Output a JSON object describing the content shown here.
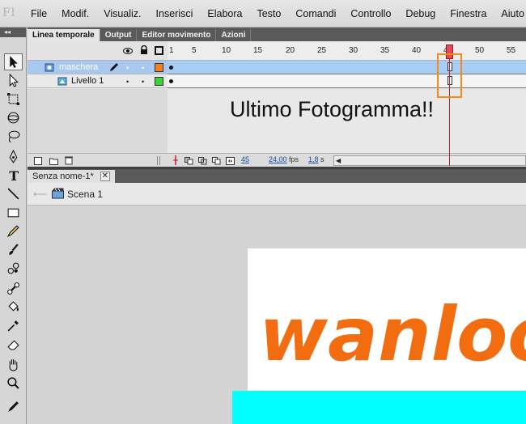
{
  "app": {
    "logo": "Fl"
  },
  "menubar": {
    "items": [
      "File",
      "Modif.",
      "Visualiz.",
      "Inserisci",
      "Elabora",
      "Testo",
      "Comandi",
      "Controllo",
      "Debug",
      "Finestra",
      "Aiuto"
    ]
  },
  "toolbar": {
    "collapse": "◂◂"
  },
  "timeline_panel": {
    "tabs": [
      {
        "label": "Linea temporale",
        "active": true
      },
      {
        "label": "Output",
        "active": false
      },
      {
        "label": "Editor movimento",
        "active": false
      },
      {
        "label": "Azioni",
        "active": false
      }
    ],
    "ruler": [
      "1",
      "5",
      "10",
      "15",
      "20",
      "25",
      "30",
      "35",
      "40",
      "45",
      "50",
      "55"
    ],
    "layers": [
      {
        "name": "maschera",
        "selected": true,
        "color": "#f08020"
      },
      {
        "name": "Livello 1",
        "selected": false,
        "color": "#3cd23c"
      }
    ],
    "annotation": "Ultimo Fotogramma!!",
    "footer": {
      "current_frame": "45",
      "fps_value": "24,00",
      "fps_label": "fps",
      "time_value": "1,8",
      "time_label": "s"
    }
  },
  "document": {
    "tab_label": "Senza nome-1*",
    "close": "✕",
    "scene": "Scena 1"
  },
  "stage": {
    "logo_text": "wanloo",
    "logo_color": "#f26c10",
    "rect_color": "#00ffff"
  }
}
